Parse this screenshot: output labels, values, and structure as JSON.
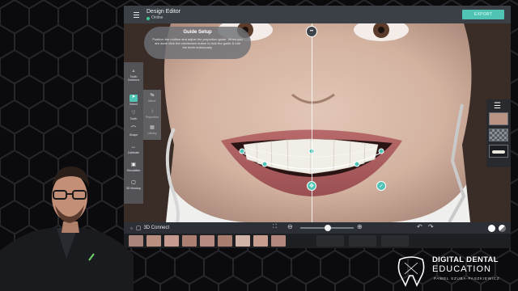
{
  "app": {
    "title": "Design Editor",
    "status": "Online",
    "export_label": "EXPORT"
  },
  "guide": {
    "heading": "Guide Setup",
    "body": "Position the midline and adjust the proportion guide. When you are done click the checkmark button to lock the guide & edit the teeth individually."
  },
  "toolbox": {
    "items": [
      {
        "label": "Tooth Contours",
        "icon": "tooth-icon"
      },
      {
        "label": "Select",
        "icon": "cursor-icon"
      },
      {
        "label": "Tooth",
        "icon": "tooth-outline-icon"
      },
      {
        "label": "Shape",
        "icon": "curve-icon"
      },
      {
        "label": "Calibrate",
        "icon": "calibrate-icon"
      },
      {
        "label": "Simulation",
        "icon": "document-icon"
      },
      {
        "label": "3D Mockup",
        "icon": "cube-icon"
      }
    ],
    "secondary": [
      {
        "label": "Mirror"
      },
      {
        "label": "Proportion"
      },
      {
        "label": "Library"
      }
    ]
  },
  "bottombar": {
    "connect_label": "3D Connect"
  },
  "logo": {
    "line1": "DIGITAL DENTAL",
    "line2": "EDUCATION",
    "line3": "PAWEL SZUBA-PASZKIEWICZ"
  },
  "colors": {
    "accent": "#4fc3b4",
    "titlebar": "#3b3f46",
    "guide_line": "#ffffff"
  }
}
